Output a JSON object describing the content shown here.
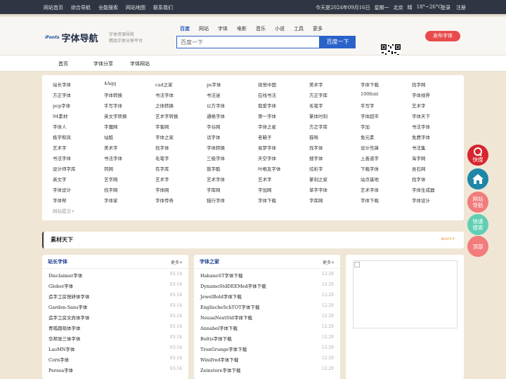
{
  "topbar": {
    "links": [
      "网站首页",
      "综合导航",
      "全能搜索",
      "网站地图",
      "联系我们"
    ],
    "date": "今天是2024年09月16日",
    "weekday": "星期一",
    "city": "北京",
    "weather": "晴",
    "temp": "18°~26°C",
    "login": "登录",
    "register": "注册"
  },
  "header": {
    "logo_mark": "iFonts",
    "logo_name": "字体导航",
    "slogan_1": "字体资源导航",
    "slogan_2": "精品字体分享平台",
    "search_tabs": [
      "百度",
      "网站",
      "字体",
      "电影",
      "音乐",
      "小说",
      "工具",
      "更多"
    ],
    "search_placeholder": "百度一下",
    "search_button": "百度一下",
    "publish_button": "发布字体"
  },
  "nav": [
    "首页",
    "字体分享",
    "字体网站"
  ],
  "sites": {
    "rows": [
      [
        "站长字体",
        "4Aqq",
        "cad之家",
        "ps字体",
        "视觉中国",
        "美术字",
        "字体下载",
        "找字网"
      ],
      [
        "方正字体",
        "字体转换",
        "书法字体",
        "书法迷",
        "在线书法",
        "方正字库",
        "100font",
        "字体视界"
      ],
      [
        "pop字体",
        "手写字体",
        "之体转换",
        "以方字体",
        "我爱字体",
        "毛笔字",
        "手写字",
        "艺术字"
      ],
      [
        "94素材",
        "英文字转换",
        "艺术字转换",
        "通格字体",
        "第一字体",
        "篆体时刻",
        "字体超市",
        "字体天下"
      ],
      [
        "字体人",
        "字魔网",
        "字客网",
        "字谷网",
        "字体之星",
        "方正字库",
        "字加",
        "书法字体"
      ],
      [
        "极字和风",
        "站酷",
        "字体之家",
        "话字体",
        "老鞋子",
        "猫啃",
        "免元素",
        "免费字体"
      ],
      [
        "艺术字",
        "美术字",
        "找字体",
        "字体转换",
        "易梦字体",
        "找字体",
        "设计先锋",
        "书法集"
      ],
      [
        "书法字体",
        "书法字体",
        "毛笔字",
        "三极字体",
        "天空字体",
        "搜字体",
        "上善道字",
        "淘字网"
      ],
      [
        "设计师字库",
        "钙网",
        "有字库",
        "我字酷",
        "叶根友字体",
        "炫彩字",
        "下载字体",
        "邑石网"
      ],
      [
        "英文字",
        "艺字网",
        "艺术字",
        "艺术字体",
        "艺术字",
        "篆刻之家",
        "站点基地",
        "找字体"
      ],
      [
        "字体设计",
        "找字网",
        "字体网",
        "字库网",
        "字加网",
        "草字字体",
        "艺术字体",
        "字体生成器"
      ],
      [
        "字体帮",
        "字体家",
        "字体传奇",
        "猎行字体",
        "字体下载",
        "字库网",
        "字体下载",
        "字体设计"
      ]
    ],
    "submit": "网站提交+"
  },
  "material": {
    "title": "素材天下",
    "more": "more+"
  },
  "list_left": {
    "title": "站长字体",
    "more": "更多+",
    "items": [
      {
        "name": "Disclaimer字体",
        "date": "03-14"
      },
      {
        "name": "Glober字体",
        "date": "03-14"
      },
      {
        "name": "造字工房悦研体字体",
        "date": "03-14"
      },
      {
        "name": "Garden-Sans字体",
        "date": "03-14"
      },
      {
        "name": "造字工房文尚体字体",
        "date": "03-14"
      },
      {
        "name": "青呱圆萌体字体",
        "date": "03-14"
      },
      {
        "name": "华邦张三体字体",
        "date": "03-14"
      },
      {
        "name": "LaoMN字体",
        "date": "03-14"
      },
      {
        "name": "Corn字体",
        "date": "03-14"
      },
      {
        "name": "Persea字体",
        "date": "03-14"
      }
    ]
  },
  "list_mid": {
    "title": "字体之家",
    "more": "更多+",
    "items": [
      {
        "name": "HabanoST字体下载",
        "date": "12-29"
      },
      {
        "name": "DynamoStdDEEMed字体下载",
        "date": "12-29"
      },
      {
        "name": "JewelBold字体下载",
        "date": "12-29"
      },
      {
        "name": "EnglischeSchTOT字体下载",
        "date": "12-29"
      },
      {
        "name": "NeusaNextStd字体下载",
        "date": "12-29"
      },
      {
        "name": "Annabel字体下载",
        "date": "12-29"
      },
      {
        "name": "Boltis字体下载",
        "date": "12-29"
      },
      {
        "name": "TronGrunge字体下载",
        "date": "12-29"
      },
      {
        "name": "Winifred字体下载",
        "date": "12-29"
      },
      {
        "name": "Zeinstore字体下载",
        "date": "12-29"
      }
    ]
  },
  "float_buttons": [
    {
      "icon": "q-icon",
      "label": "快搜",
      "color": "#d7262e"
    },
    {
      "icon": "home-icon",
      "label": "",
      "color": "#1e86a8"
    },
    {
      "icon": "",
      "label": "网站导航",
      "color": "#f27c7c"
    },
    {
      "icon": "",
      "label": "快速搜索",
      "color": "#5fcfb3"
    },
    {
      "icon": "",
      "label": "顶部",
      "color": "#f27c7c"
    }
  ]
}
